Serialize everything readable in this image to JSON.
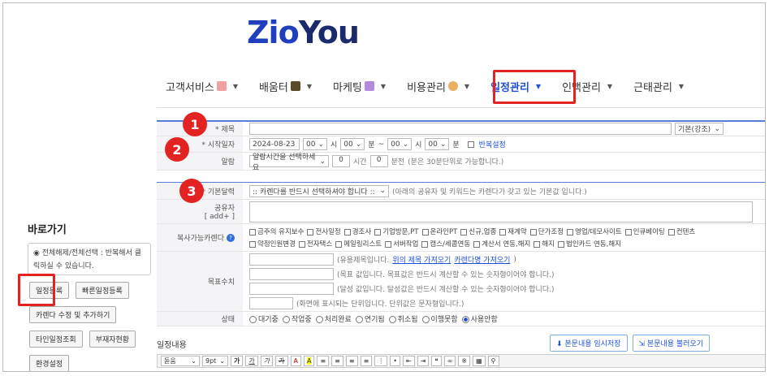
{
  "logo": {
    "part1": "Zio",
    "part2": "You"
  },
  "nav": [
    {
      "label": "고객서비스",
      "icon": "star-icon",
      "active": false
    },
    {
      "label": "배움터",
      "icon": "graduate-icon",
      "active": false
    },
    {
      "label": "마케팅",
      "icon": "people-icon",
      "active": false
    },
    {
      "label": "비용관리",
      "icon": "moneybag-icon",
      "active": false
    },
    {
      "label": "일정관리",
      "icon": "",
      "active": true
    },
    {
      "label": "인맥관리",
      "icon": "",
      "active": false
    },
    {
      "label": "근태관리",
      "icon": "",
      "active": false
    }
  ],
  "sidebar": {
    "title": "바로가기",
    "note": "전체해제/전체선택 : 반복해서 클릭하실 수 있습니다.",
    "buttons": [
      "일정등록",
      "빠른일정등록",
      "카렌다 수정 및 추가하기",
      "타인일정조회",
      "부재자현황",
      "환경설정"
    ]
  },
  "form": {
    "title_label": "* 제목",
    "title_style": "기본(강조)",
    "start_label": "* 시작일자",
    "start_date": "2024-08-23",
    "hour1": "00",
    "hour_unit": "시",
    "min1": "00",
    "min_unit": "분",
    "dash": "~",
    "hour2": "00",
    "min2": "00",
    "repeat": "반복설정",
    "alarm_label": "알람",
    "alarm_select": "알람시간을 선택하세요",
    "alarm_h": "0",
    "alarm_h_unit": "시간",
    "alarm_m": "0",
    "alarm_m_unit": "분전",
    "alarm_note": "(분은 30분단위로 가능합니다.)",
    "calendar_label": "* 기본달력",
    "calendar_select": ":: 카렌다를 반드시 선택하셔야 합니다 ::",
    "calendar_note": "(아래의 공유자 및 키워드는 카렌다가 갖고 있는 기본값 입니다.)",
    "sharer_label": "공유자",
    "sharer_add": "[ add+ ]",
    "copy_label": "복사가능카렌다",
    "copy_row1": [
      "금주의 유지보수",
      "전사일정",
      "경조사",
      "기업방문,PT",
      "온라인PT",
      "신규,업종",
      "재계약",
      "단가조정",
      "영업/데모사이트",
      "인큐베이팅",
      "컨텐츠"
    ],
    "copy_row2": [
      "약정인원변경",
      "전자택스",
      "메일링리스트",
      "서버작업",
      "캠스/세콤연동",
      "계산서 연동,해지",
      "해지",
      "법인카드 연동,해지"
    ],
    "target_label": "목표수치",
    "target_hint1_pre": "(유용제목입니다.",
    "target_link1": "위의 제목 가져오기",
    "target_link2": "카렌다명 가져오기",
    "target_hint1_post": ")",
    "target_hint2": "(목표 값입니다. 목표값은 반드시 계산할 수 있는 숫자형이어야 합니다.)",
    "target_hint3": "(달성 값입니다. 달성값은 반드시 계산할 수 있는 숫자형이어야 합니다.)",
    "target_hint4": "(화면에 표시되는 단위입니다. 단위값은 문자형입니다.)",
    "status_label": "상태",
    "statuses": [
      "대기중",
      "작업중",
      "처리완료",
      "연기됨",
      "취소됨",
      "이행못함",
      "사용안함"
    ],
    "status_selected": "사용안함",
    "content_label": "일정내용",
    "save_temp": "본문내용 임시저장",
    "load_temp": "본문내용 불러오기"
  },
  "toolbar": {
    "font": "돋움",
    "size": "9pt",
    "bold": "가",
    "underline": "가",
    "italic": "가",
    "strike": "가"
  },
  "markers": [
    "1",
    "2",
    "3"
  ]
}
